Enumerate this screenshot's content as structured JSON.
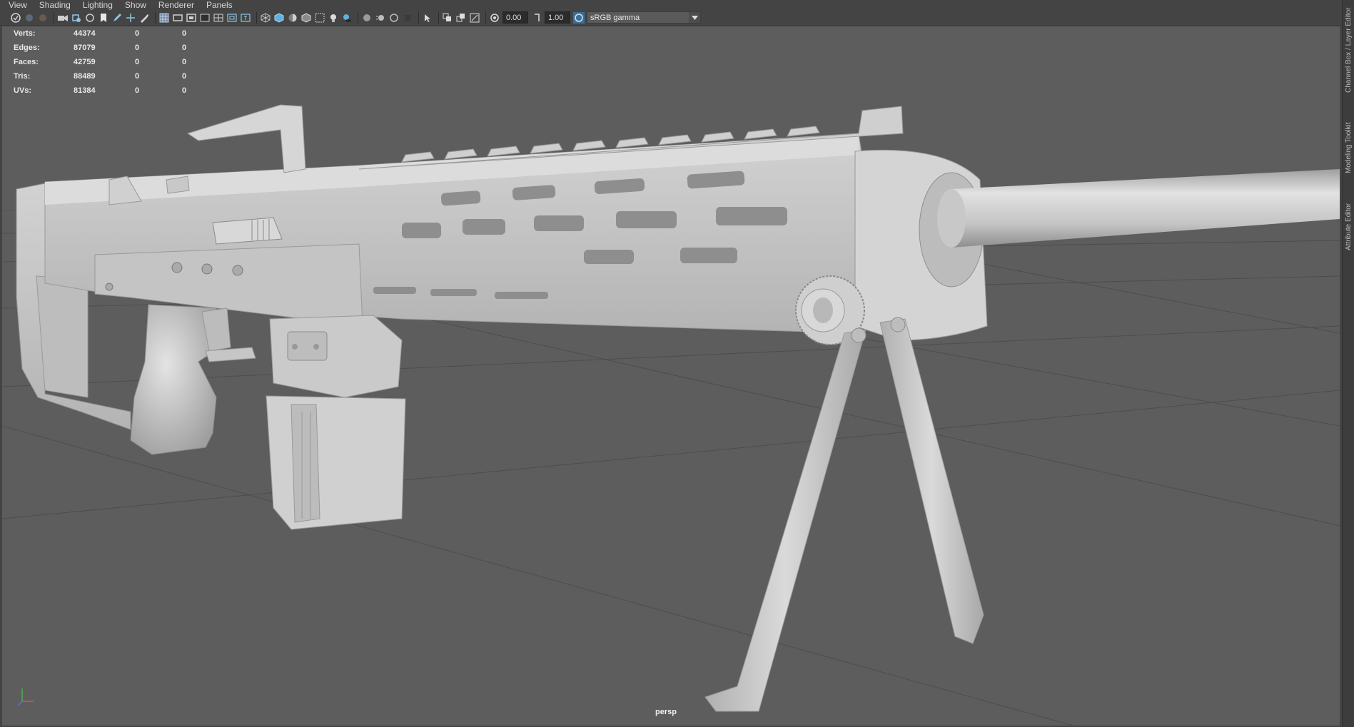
{
  "menubar": {
    "items": [
      "View",
      "Shading",
      "Lighting",
      "Show",
      "Renderer",
      "Panels"
    ]
  },
  "toolbar": {
    "exposure_value": "0.00",
    "gamma_value": "1.00",
    "color_space": "sRGB gamma",
    "icons": [
      "select-camera-icon",
      "camera-attributes-icon",
      "bookmark-icon",
      "image-plane-icon",
      "grid-icon",
      "film-gate-icon",
      "resolution-gate-icon",
      "gate-mask-icon",
      "field-chart-icon",
      "safe-action-icon",
      "safe-title-icon",
      "wireframe-icon",
      "smooth-shade-icon",
      "default-material-icon",
      "wireframe-on-shaded-icon",
      "xray-icon",
      "use-all-lights-icon",
      "shadows-icon",
      "screen-space-ao-icon",
      "motion-blur-icon",
      "anti-aliasing-icon",
      "depth-of-field-icon",
      "isolate-select-icon",
      "xray-joints-icon",
      "xray-active-components-icon",
      "backface-culling-icon",
      "exposure-icon",
      "gamma-icon",
      "color-management-icon"
    ]
  },
  "hud": {
    "rows": [
      {
        "label": "Verts:",
        "c1": "44374",
        "c2": "0",
        "c3": "0"
      },
      {
        "label": "Edges:",
        "c1": "87079",
        "c2": "0",
        "c3": "0"
      },
      {
        "label": "Faces:",
        "c1": "42759",
        "c2": "0",
        "c3": "0"
      },
      {
        "label": "Tris:",
        "c1": "88489",
        "c2": "0",
        "c3": "0"
      },
      {
        "label": "UVs:",
        "c1": "81384",
        "c2": "0",
        "c3": "0"
      }
    ]
  },
  "viewport": {
    "camera": "persp",
    "background_color": "#5d5d5d",
    "model_color": "#c8c8c8"
  },
  "right_dock": {
    "tabs": [
      "Channel Box / Layer Editor",
      "Modeling Toolkit",
      "Attribute Editor"
    ]
  }
}
